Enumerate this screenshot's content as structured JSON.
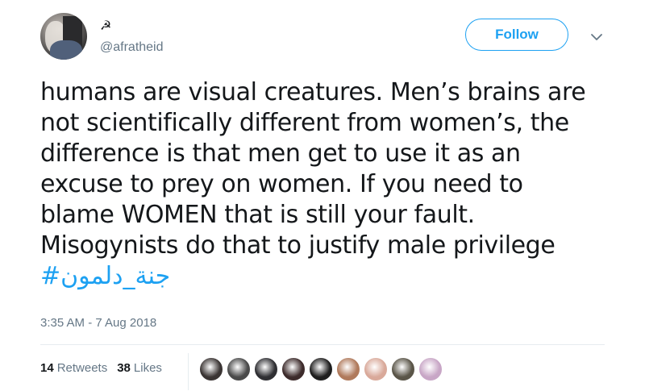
{
  "user": {
    "display_name_glyph": "☭",
    "handle": "@afratheid"
  },
  "follow_button": "Follow",
  "tweet": {
    "lines": [
      "humans are visual creatures. Men’s brains are",
      "not scientifically different from women’s, the",
      "difference is that men get to use it as an",
      "excuse to prey on women. If you need to",
      "blame WOMEN that is still your fault.",
      "Misogynists do that to justify male privilege"
    ],
    "hashtag": "#جنة_دلمون"
  },
  "timestamp": "3:35 AM - 7 Aug 2018",
  "stats": {
    "retweets_count": "14",
    "retweets_label": "Retweets",
    "likes_count": "38",
    "likes_label": "Likes"
  },
  "likers": [
    {
      "color": "#3a3433"
    },
    {
      "color": "#4a4a4a"
    },
    {
      "color": "#2f2f33"
    },
    {
      "color": "#3d2b2b"
    },
    {
      "color": "#1f1e1e"
    },
    {
      "color": "#b07a5c"
    },
    {
      "color": "#d9a99a"
    },
    {
      "color": "#5a5548"
    },
    {
      "color": "#c8a6c6"
    }
  ],
  "colors": {
    "accent": "#1da1f2",
    "secondary_text": "#657786",
    "primary_text": "#14171a"
  },
  "icons": {
    "caret": "chevron-down-icon"
  }
}
